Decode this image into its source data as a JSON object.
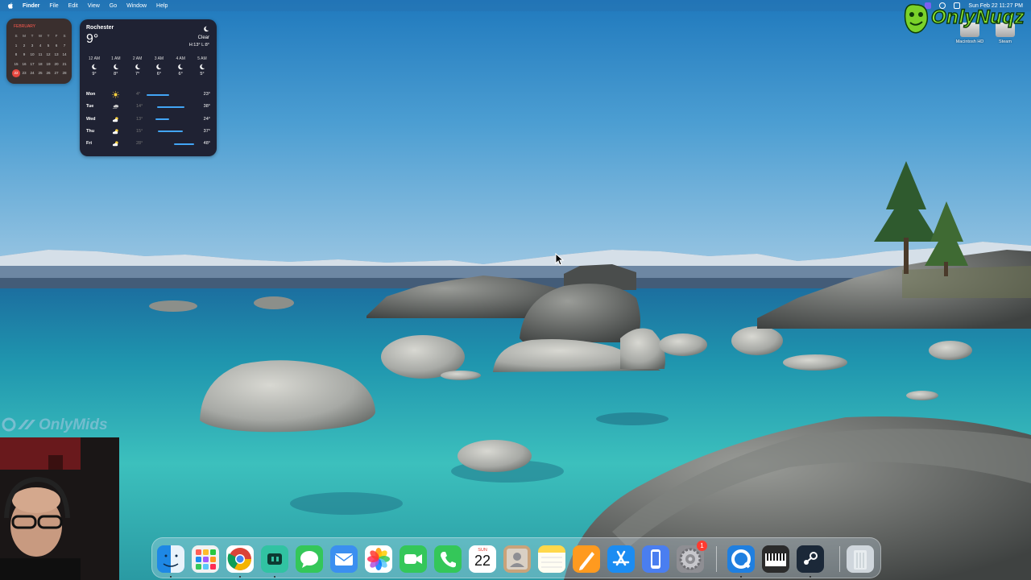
{
  "menubar": {
    "app_name": "Finder",
    "menus": [
      "File",
      "Edit",
      "View",
      "Go",
      "Window",
      "Help"
    ],
    "clock": "Sun Feb 22  11:27 PM"
  },
  "calendar_widget": {
    "month": "FEBRUARY",
    "weekday_headers": [
      "S",
      "M",
      "T",
      "W",
      "T",
      "F",
      "S"
    ],
    "days": [
      "1",
      "2",
      "3",
      "4",
      "5",
      "6",
      "7",
      "8",
      "9",
      "10",
      "11",
      "12",
      "13",
      "14",
      "15",
      "16",
      "17",
      "18",
      "19",
      "20",
      "21",
      "22",
      "23",
      "24",
      "25",
      "26",
      "27",
      "28"
    ],
    "today": "22"
  },
  "weather": {
    "city": "Rochester",
    "temp": "9°",
    "condition": "Clear",
    "hilo": "H:13° L:8°",
    "icon": "moon-icon",
    "hourly": [
      {
        "time": "12 AM",
        "temp": "9°"
      },
      {
        "time": "1 AM",
        "temp": "8°"
      },
      {
        "time": "2 AM",
        "temp": "7°"
      },
      {
        "time": "3 AM",
        "temp": "6°"
      },
      {
        "time": "4 AM",
        "temp": "6°"
      },
      {
        "time": "5 AM",
        "temp": "5°"
      }
    ],
    "daily": [
      {
        "day": "Mon",
        "icon": "sun-icon",
        "low": "4°",
        "high": "23°",
        "bar_start": 0.05,
        "bar_end": 0.5
      },
      {
        "day": "Tue",
        "icon": "wind-cloud-icon",
        "low": "14°",
        "high": "38°",
        "bar_start": 0.25,
        "bar_end": 0.8
      },
      {
        "day": "Wed",
        "icon": "partly-cloudy-icon",
        "low": "13°",
        "high": "24°",
        "bar_start": 0.22,
        "bar_end": 0.5
      },
      {
        "day": "Thu",
        "icon": "partly-cloudy-icon",
        "low": "15°",
        "high": "37°",
        "bar_start": 0.27,
        "bar_end": 0.78
      },
      {
        "day": "Fri",
        "icon": "partly-cloudy-icon",
        "low": "28°",
        "high": "48°",
        "bar_start": 0.6,
        "bar_end": 1.0
      }
    ]
  },
  "desktop_icons": [
    {
      "label": "Macintosh HD"
    },
    {
      "label": "Steam"
    }
  ],
  "overlays": {
    "top_logo": "OnlyNuqz",
    "left_logo": "OnlyMids"
  },
  "dock": {
    "items": [
      {
        "name": "Finder",
        "icon": "finder-icon",
        "color": "#1e88e5"
      },
      {
        "name": "Launchpad",
        "icon": "launchpad-icon",
        "color": "#f2f2f2"
      },
      {
        "name": "Google Chrome",
        "icon": "chrome-icon",
        "color": "#ffffff"
      },
      {
        "name": "Streamlabs",
        "icon": "streamlabs-icon",
        "color": "#31c3a2"
      },
      {
        "name": "Messages",
        "icon": "messages-icon",
        "color": "#34c759"
      },
      {
        "name": "Mail",
        "icon": "mail-icon",
        "color": "#3b8ff0"
      },
      {
        "name": "Photos",
        "icon": "photos-icon",
        "color": "#ffffff"
      },
      {
        "name": "FaceTime",
        "icon": "facetime-icon",
        "color": "#34c759"
      },
      {
        "name": "Phone",
        "icon": "phone-icon",
        "color": "#34c759"
      },
      {
        "name": "Calendar",
        "icon": "calendar-icon",
        "month": "SUN",
        "day": "22"
      },
      {
        "name": "Contacts",
        "icon": "contacts-icon",
        "color": "#c9a37a"
      },
      {
        "name": "Notes",
        "icon": "notes-icon",
        "color": "#ffd84a"
      },
      {
        "name": "Pages",
        "icon": "pages-icon",
        "color": "#ff9a1f"
      },
      {
        "name": "App Store",
        "icon": "app-store-icon",
        "color": "#1b8cf2"
      },
      {
        "name": "iPhone Mirroring",
        "icon": "iphone-mirroring-icon",
        "color": "#4a7ef0"
      },
      {
        "name": "System Settings",
        "icon": "system-settings-icon",
        "color": "#8e8e93",
        "badge": "1"
      },
      {
        "name": "QuickTime Player",
        "icon": "quicktime-icon",
        "color": "#1f7fe0"
      },
      {
        "name": "Piano",
        "icon": "piano-icon",
        "color": "#2b2b2b"
      },
      {
        "name": "Steam",
        "icon": "steam-icon",
        "color": "#1b2838"
      },
      {
        "name": "Trash",
        "icon": "trash-icon",
        "color": "#cfd6dc"
      }
    ]
  }
}
